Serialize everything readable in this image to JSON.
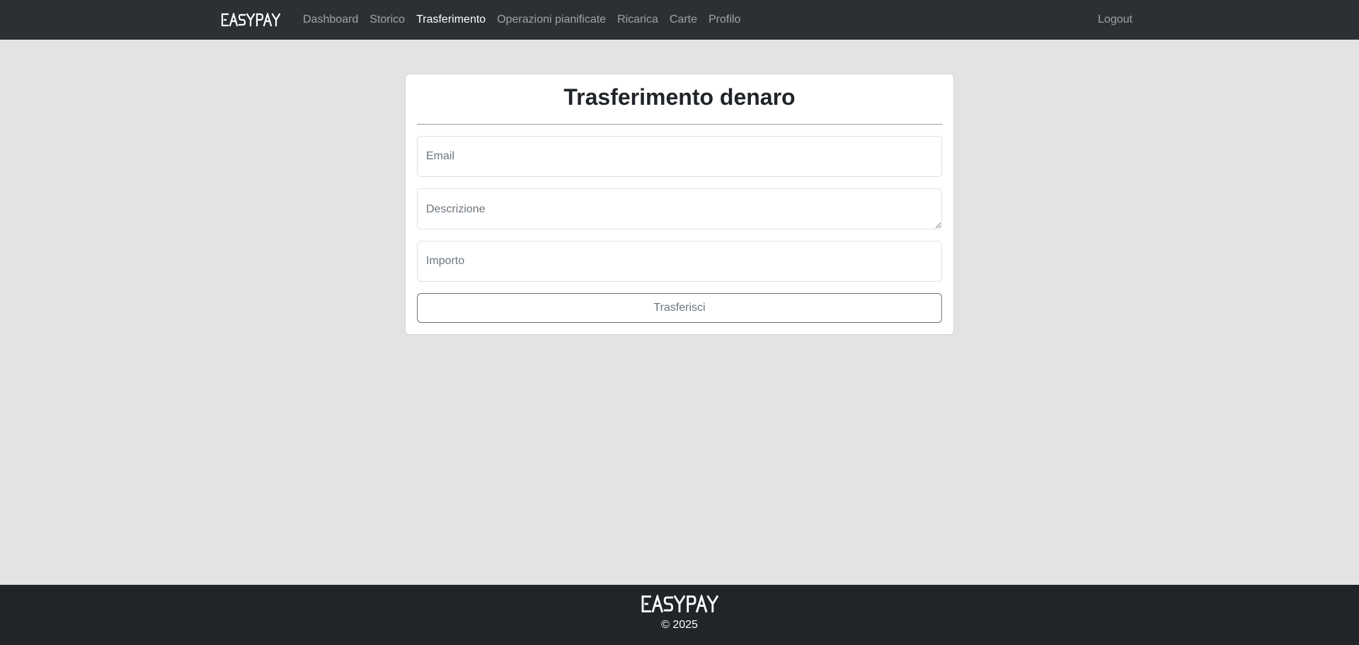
{
  "brand": {
    "name": "EASYPAY"
  },
  "nav": {
    "items": [
      {
        "label": "Dashboard",
        "active": false
      },
      {
        "label": "Storico",
        "active": false
      },
      {
        "label": "Trasferimento",
        "active": true
      },
      {
        "label": "Operazioni pianificate",
        "active": false
      },
      {
        "label": "Ricarica",
        "active": false
      },
      {
        "label": "Carte",
        "active": false
      },
      {
        "label": "Profilo",
        "active": false
      }
    ],
    "logout_label": "Logout"
  },
  "form": {
    "title": "Trasferimento denaro",
    "email": {
      "placeholder": "Email",
      "value": ""
    },
    "description": {
      "placeholder": "Descrizione",
      "value": ""
    },
    "amount": {
      "placeholder": "Importo",
      "value": ""
    },
    "submit_label": "Trasferisci"
  },
  "footer": {
    "brand": "EASYPAY",
    "copyright": "© 2025"
  },
  "colors": {
    "navbar_bg": "#2b3035",
    "footer_bg": "#212529",
    "page_bg": "#e3e3e3",
    "card_bg": "#ffffff",
    "nav_active": "#ffffff",
    "nav_inactive": "#8b8e91"
  }
}
